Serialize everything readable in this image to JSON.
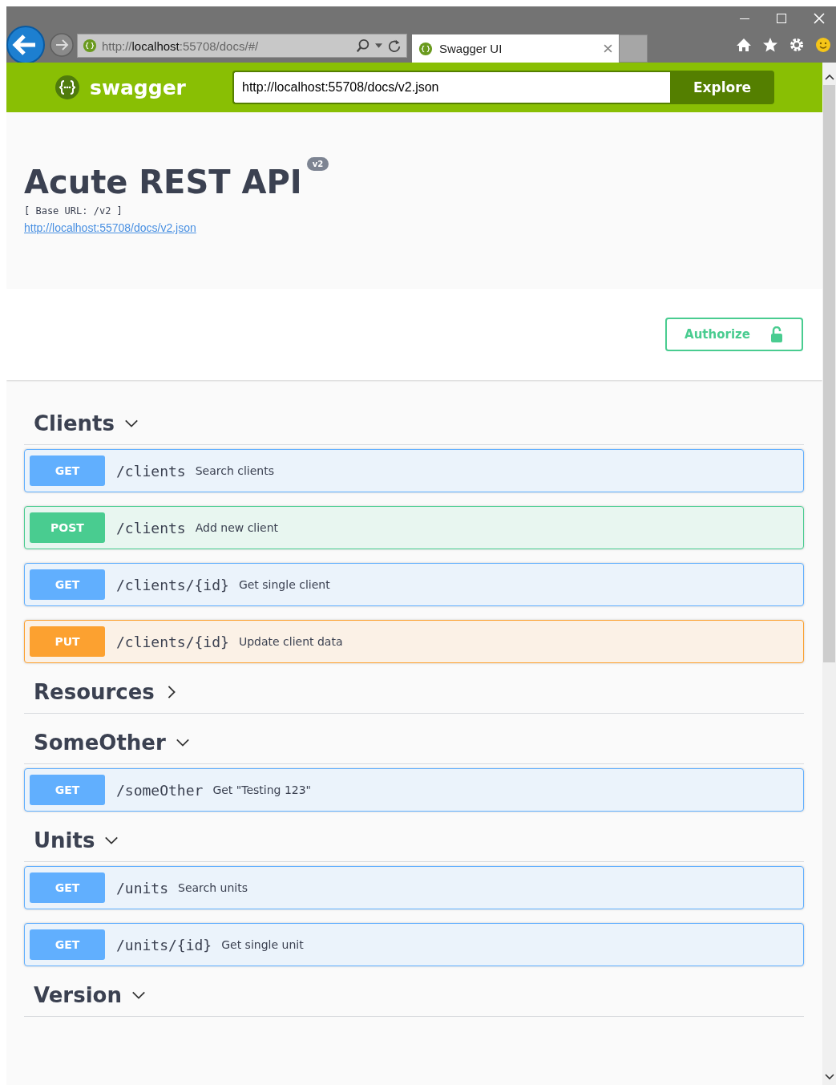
{
  "browser": {
    "address": "http://**localhost**:55708/docs/#/",
    "tabs": [
      {
        "title": "Swagger UI",
        "selected": true
      }
    ]
  },
  "topbar": {
    "brand": "swagger",
    "spec_url": "http://localhost:55708/docs/v2.json",
    "button": "Explore"
  },
  "info": {
    "title": "Acute REST API",
    "version": "v2",
    "base_url": "[ Base URL: /v2 ]",
    "spec_link": "http://localhost:55708/docs/v2.json"
  },
  "authorize": {
    "label": "Authorize",
    "locked": false
  },
  "groups": [
    {
      "name": "Clients",
      "expanded": true,
      "operations": [
        {
          "method": "GET",
          "path": "/clients",
          "summary": "Search clients"
        },
        {
          "method": "POST",
          "path": "/clients",
          "summary": "Add new client"
        },
        {
          "method": "GET",
          "path": "/clients/{id}",
          "summary": "Get single client"
        },
        {
          "method": "PUT",
          "path": "/clients/{id}",
          "summary": "Update client data"
        }
      ]
    },
    {
      "name": "Resources",
      "expanded": false
    },
    {
      "name": "SomeOther",
      "expanded": true,
      "operations": [
        {
          "method": "GET",
          "path": "/someOther",
          "summary": "Get \"Testing 123\""
        }
      ]
    },
    {
      "name": "Units",
      "expanded": true,
      "operations": [
        {
          "method": "GET",
          "path": "/units",
          "summary": "Search units"
        },
        {
          "method": "GET",
          "path": "/units/{id}",
          "summary": "Get single unit"
        }
      ]
    },
    {
      "name": "Version",
      "expanded": true
    }
  ]
}
